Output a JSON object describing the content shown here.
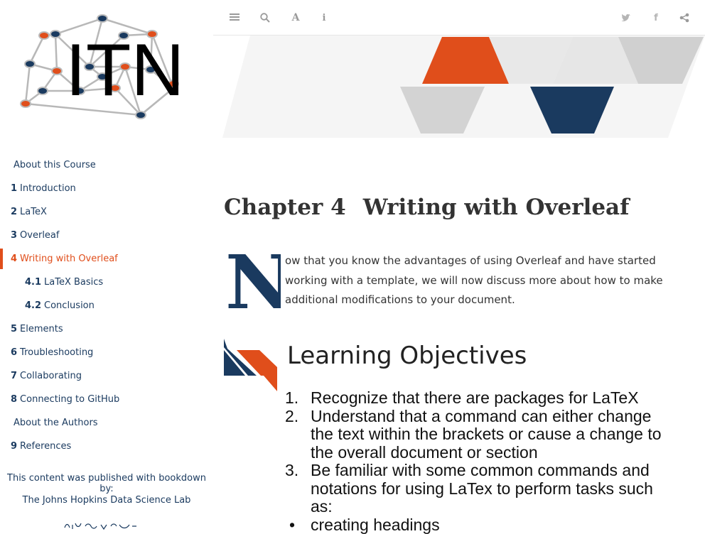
{
  "logo": {
    "text": "ITN"
  },
  "toolbar": {
    "icons": [
      "menu-icon",
      "search-icon",
      "font-icon",
      "info-icon",
      "twitter-icon",
      "facebook-icon",
      "share-icon"
    ],
    "glyphs": {
      "menu": "≡",
      "search": "⌕",
      "font": "A",
      "info": "i",
      "twitter": "♥",
      "facebook": "f",
      "share": "<"
    }
  },
  "sidebar": {
    "items": [
      {
        "num": "",
        "label": "About this Course"
      },
      {
        "num": "1",
        "label": "Introduction"
      },
      {
        "num": "2",
        "label": "LaTeX"
      },
      {
        "num": "3",
        "label": "Overleaf"
      },
      {
        "num": "4",
        "label": "Writing with Overleaf"
      },
      {
        "num": "4.1",
        "label": "LaTeX Basics"
      },
      {
        "num": "4.2",
        "label": "Conclusion"
      },
      {
        "num": "5",
        "label": "Elements"
      },
      {
        "num": "6",
        "label": "Troubleshooting"
      },
      {
        "num": "7",
        "label": "Collaborating"
      },
      {
        "num": "8",
        "label": "Connecting to GitHub"
      },
      {
        "num": "",
        "label": "About the Authors"
      },
      {
        "num": "9",
        "label": "References"
      }
    ],
    "published_text": "This content was published with bookdown by:",
    "publisher_link": "The Johns Hopkins Data Science Lab"
  },
  "chapter": {
    "prefix": "Chapter 4",
    "title": "Writing with Overleaf",
    "dropcap": "N",
    "intro": "ow that you know the advantages of using Overleaf and have started working with a template, we will now discuss more about how to make additional modifications to your document."
  },
  "objectives": {
    "heading": "Learning Objectives",
    "items": [
      {
        "marker": "1.",
        "text": "Recognize that there are packages for LaTeX"
      },
      {
        "marker": "2.",
        "text": "Understand that a command can either change the text within the brackets or cause a change to the overall document or section"
      },
      {
        "marker": "3.",
        "text": "Be familiar with some common commands and notations for using LaTex to perform tasks such as:"
      },
      {
        "marker": "•",
        "text": "creating headings"
      }
    ]
  },
  "colors": {
    "accent": "#e04e1b",
    "navy": "#1a3a5f",
    "text": "#333333"
  }
}
